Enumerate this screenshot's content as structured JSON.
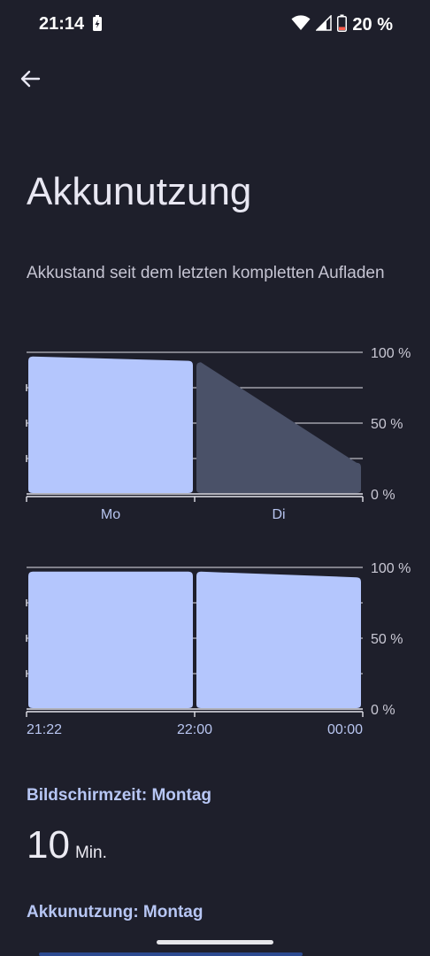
{
  "status_bar": {
    "time": "21:14",
    "battery_percent": "20 %",
    "icons": [
      "charging-icon",
      "wifi-icon",
      "cell-signal-icon",
      "battery-icon"
    ]
  },
  "header": {
    "back_icon": "arrow-left-icon",
    "title": "Akkunutzung",
    "subtitle": "Akkustand seit dem letzten kompletten Aufladen"
  },
  "colors": {
    "background": "#1e1f2b",
    "bar_fill": "#b4c6fd",
    "bar_fill_muted": "#4a5168",
    "grid": "#e2e2ea",
    "accent_text": "#b7c6f4"
  },
  "chart_data": [
    {
      "type": "area",
      "y_tick_labels": [
        "100 %",
        "50 %",
        "0 %"
      ],
      "ylim": [
        0,
        100
      ],
      "x_tick_labels": [
        "Mo",
        "Di"
      ],
      "series": [
        {
          "values": [
            97,
            94
          ],
          "segment": "Mo",
          "style": "solid"
        },
        {
          "values": [
            93,
            22
          ],
          "segment": "Di",
          "style": "muted"
        }
      ]
    },
    {
      "type": "area",
      "y_tick_labels": [
        "100 %",
        "50 %",
        "0 %"
      ],
      "ylim": [
        0,
        100
      ],
      "x_tick_labels": [
        "21:22",
        "22:00",
        "00:00"
      ],
      "series": [
        {
          "values": [
            97,
            97
          ],
          "segment": "21:22-22:00",
          "style": "solid"
        },
        {
          "values": [
            97,
            93
          ],
          "segment": "22:00-00:00",
          "style": "solid"
        }
      ]
    }
  ],
  "screen_time": {
    "heading": "Bildschirmzeit: Montag",
    "value": "10",
    "unit": "Min."
  },
  "battery_usage": {
    "heading": "Akkunutzung: Montag"
  }
}
